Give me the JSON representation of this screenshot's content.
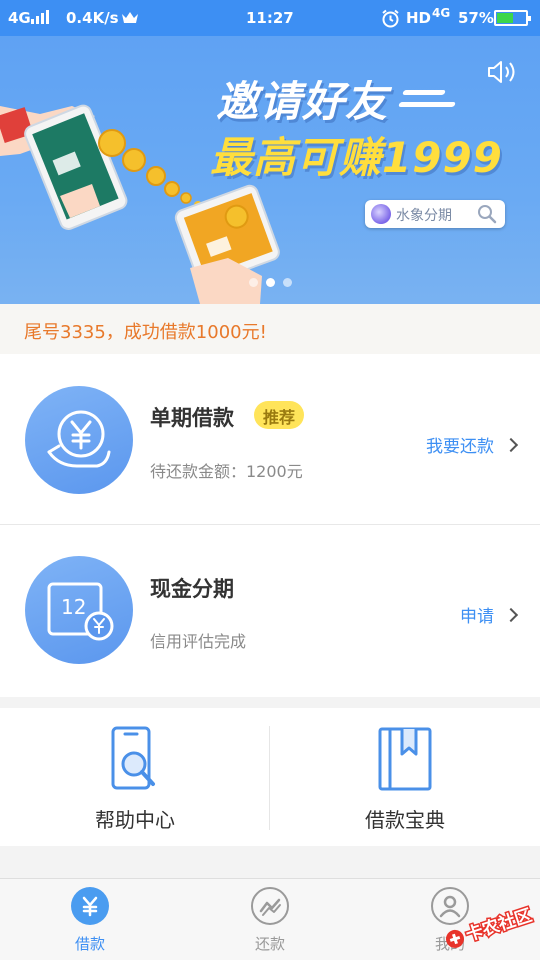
{
  "status_bar": {
    "network": "4G",
    "speed": "0.4K/s",
    "time": "11:27",
    "hd_label": "HD",
    "network2": "4G",
    "battery": "57%",
    "battery_level": 0.57
  },
  "banner": {
    "line1": "邀请好友",
    "line2": "最高可赚1999",
    "search_text": "水象分期",
    "slide_count": 3,
    "active_slide": 2
  },
  "notice": {
    "text": "尾号3335，成功借款1000元!"
  },
  "products": [
    {
      "title": "单期借款",
      "badge": "推荐",
      "subtitle": "待还款金额：1200元",
      "action": "我要还款",
      "icon": "yuan-hand-icon"
    },
    {
      "title": "现金分期",
      "subtitle": "信用评估完成",
      "action": "申请",
      "icon": "calendar-12-yuan-icon",
      "icon_text": "12"
    }
  ],
  "tools": [
    {
      "label": "帮助中心",
      "icon": "phone-search-icon"
    },
    {
      "label": "借款宝典",
      "icon": "book-bookmark-icon"
    }
  ],
  "bottom_nav": {
    "active": 0,
    "items": [
      {
        "label": "借款",
        "icon": "yuan-icon",
        "glyph": "¥"
      },
      {
        "label": "还款",
        "icon": "trend-icon"
      },
      {
        "label": "我的",
        "icon": "user-icon"
      }
    ]
  },
  "watermark": {
    "text": "卡农社区"
  },
  "colors": {
    "primary": "#3d8ff3",
    "badge_bg": "#ffe45a",
    "notice_text": "#e8792b",
    "banner_yellow": "#ffde3d"
  }
}
